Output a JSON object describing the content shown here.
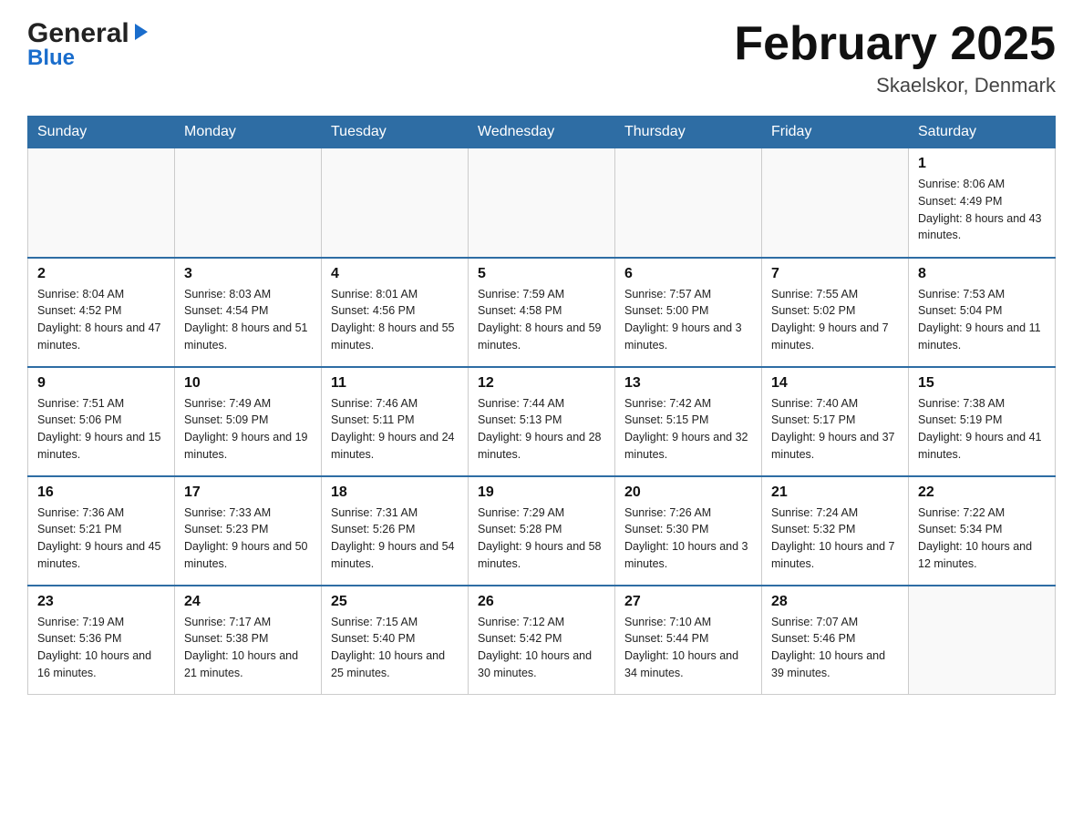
{
  "header": {
    "logo_top": "General",
    "logo_bottom": "Blue",
    "month_title": "February 2025",
    "location": "Skaelskor, Denmark"
  },
  "days_of_week": [
    "Sunday",
    "Monday",
    "Tuesday",
    "Wednesday",
    "Thursday",
    "Friday",
    "Saturday"
  ],
  "weeks": [
    {
      "days": [
        {
          "number": "",
          "info": ""
        },
        {
          "number": "",
          "info": ""
        },
        {
          "number": "",
          "info": ""
        },
        {
          "number": "",
          "info": ""
        },
        {
          "number": "",
          "info": ""
        },
        {
          "number": "",
          "info": ""
        },
        {
          "number": "1",
          "info": "Sunrise: 8:06 AM\nSunset: 4:49 PM\nDaylight: 8 hours\nand 43 minutes."
        }
      ]
    },
    {
      "days": [
        {
          "number": "2",
          "info": "Sunrise: 8:04 AM\nSunset: 4:52 PM\nDaylight: 8 hours\nand 47 minutes."
        },
        {
          "number": "3",
          "info": "Sunrise: 8:03 AM\nSunset: 4:54 PM\nDaylight: 8 hours\nand 51 minutes."
        },
        {
          "number": "4",
          "info": "Sunrise: 8:01 AM\nSunset: 4:56 PM\nDaylight: 8 hours\nand 55 minutes."
        },
        {
          "number": "5",
          "info": "Sunrise: 7:59 AM\nSunset: 4:58 PM\nDaylight: 8 hours\nand 59 minutes."
        },
        {
          "number": "6",
          "info": "Sunrise: 7:57 AM\nSunset: 5:00 PM\nDaylight: 9 hours\nand 3 minutes."
        },
        {
          "number": "7",
          "info": "Sunrise: 7:55 AM\nSunset: 5:02 PM\nDaylight: 9 hours\nand 7 minutes."
        },
        {
          "number": "8",
          "info": "Sunrise: 7:53 AM\nSunset: 5:04 PM\nDaylight: 9 hours\nand 11 minutes."
        }
      ]
    },
    {
      "days": [
        {
          "number": "9",
          "info": "Sunrise: 7:51 AM\nSunset: 5:06 PM\nDaylight: 9 hours\nand 15 minutes."
        },
        {
          "number": "10",
          "info": "Sunrise: 7:49 AM\nSunset: 5:09 PM\nDaylight: 9 hours\nand 19 minutes."
        },
        {
          "number": "11",
          "info": "Sunrise: 7:46 AM\nSunset: 5:11 PM\nDaylight: 9 hours\nand 24 minutes."
        },
        {
          "number": "12",
          "info": "Sunrise: 7:44 AM\nSunset: 5:13 PM\nDaylight: 9 hours\nand 28 minutes."
        },
        {
          "number": "13",
          "info": "Sunrise: 7:42 AM\nSunset: 5:15 PM\nDaylight: 9 hours\nand 32 minutes."
        },
        {
          "number": "14",
          "info": "Sunrise: 7:40 AM\nSunset: 5:17 PM\nDaylight: 9 hours\nand 37 minutes."
        },
        {
          "number": "15",
          "info": "Sunrise: 7:38 AM\nSunset: 5:19 PM\nDaylight: 9 hours\nand 41 minutes."
        }
      ]
    },
    {
      "days": [
        {
          "number": "16",
          "info": "Sunrise: 7:36 AM\nSunset: 5:21 PM\nDaylight: 9 hours\nand 45 minutes."
        },
        {
          "number": "17",
          "info": "Sunrise: 7:33 AM\nSunset: 5:23 PM\nDaylight: 9 hours\nand 50 minutes."
        },
        {
          "number": "18",
          "info": "Sunrise: 7:31 AM\nSunset: 5:26 PM\nDaylight: 9 hours\nand 54 minutes."
        },
        {
          "number": "19",
          "info": "Sunrise: 7:29 AM\nSunset: 5:28 PM\nDaylight: 9 hours\nand 58 minutes."
        },
        {
          "number": "20",
          "info": "Sunrise: 7:26 AM\nSunset: 5:30 PM\nDaylight: 10 hours\nand 3 minutes."
        },
        {
          "number": "21",
          "info": "Sunrise: 7:24 AM\nSunset: 5:32 PM\nDaylight: 10 hours\nand 7 minutes."
        },
        {
          "number": "22",
          "info": "Sunrise: 7:22 AM\nSunset: 5:34 PM\nDaylight: 10 hours\nand 12 minutes."
        }
      ]
    },
    {
      "days": [
        {
          "number": "23",
          "info": "Sunrise: 7:19 AM\nSunset: 5:36 PM\nDaylight: 10 hours\nand 16 minutes."
        },
        {
          "number": "24",
          "info": "Sunrise: 7:17 AM\nSunset: 5:38 PM\nDaylight: 10 hours\nand 21 minutes."
        },
        {
          "number": "25",
          "info": "Sunrise: 7:15 AM\nSunset: 5:40 PM\nDaylight: 10 hours\nand 25 minutes."
        },
        {
          "number": "26",
          "info": "Sunrise: 7:12 AM\nSunset: 5:42 PM\nDaylight: 10 hours\nand 30 minutes."
        },
        {
          "number": "27",
          "info": "Sunrise: 7:10 AM\nSunset: 5:44 PM\nDaylight: 10 hours\nand 34 minutes."
        },
        {
          "number": "28",
          "info": "Sunrise: 7:07 AM\nSunset: 5:46 PM\nDaylight: 10 hours\nand 39 minutes."
        },
        {
          "number": "",
          "info": ""
        }
      ]
    }
  ]
}
